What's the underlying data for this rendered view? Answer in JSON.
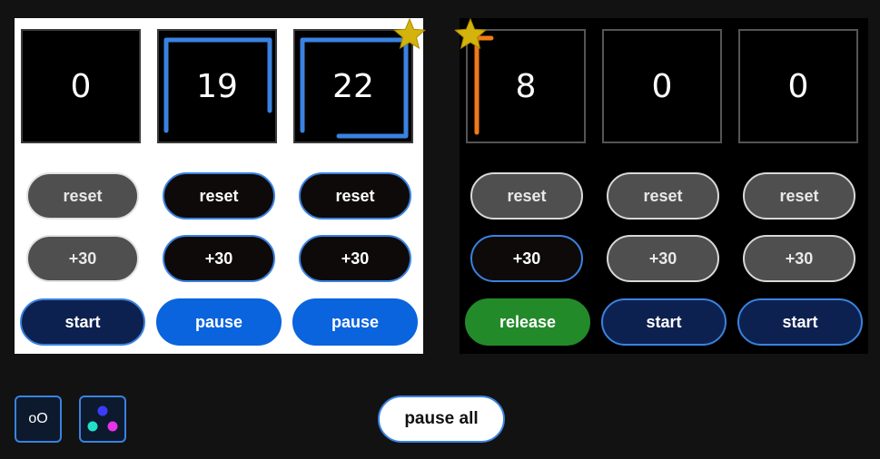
{
  "panels": [
    {
      "theme": "light",
      "timers": [
        {
          "value": "0",
          "progress": 0
        },
        {
          "value": "19",
          "progress": 0.45
        },
        {
          "value": "22",
          "progress": 0.8
        }
      ],
      "reset_labels": [
        "reset",
        "reset",
        "reset"
      ],
      "add_labels": [
        "+30",
        "+30",
        "+30"
      ],
      "action_labels": [
        "start",
        "pause",
        "pause"
      ]
    },
    {
      "theme": "dark",
      "timers": [
        {
          "value": "8",
          "progress": 0.2
        },
        {
          "value": "0",
          "progress": 0
        },
        {
          "value": "0",
          "progress": 0
        }
      ],
      "reset_labels": [
        "reset",
        "reset",
        "reset"
      ],
      "add_labels": [
        "+30",
        "+30",
        "+30"
      ],
      "action_labels": [
        "release",
        "start",
        "start"
      ]
    }
  ],
  "footer": {
    "toggle_label": "oO",
    "pause_all_label": "pause all"
  },
  "colors": {
    "progress_blue": "#3a82e0",
    "progress_orange": "#f07a1a",
    "star": "#d4b40c",
    "dots": [
      "#3c3cff",
      "#22e0c8",
      "#e633e6"
    ]
  }
}
